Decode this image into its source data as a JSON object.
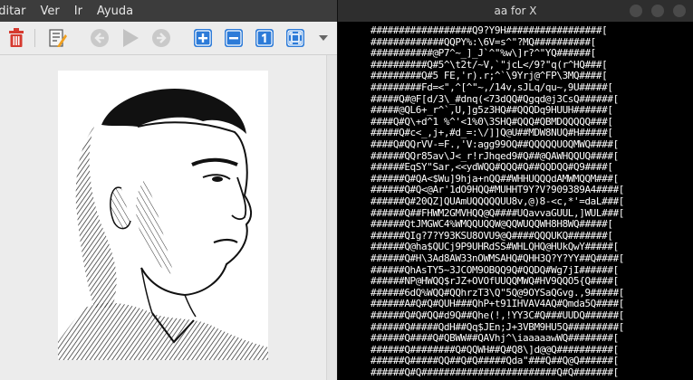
{
  "menubar": {
    "items": [
      "Editar",
      "Ver",
      "Ir",
      "Ayuda"
    ]
  },
  "toolbar": {
    "icons": [
      "trash-icon",
      "edit-icon",
      "back-arrow-icon",
      "play-icon",
      "forward-arrow-icon",
      "zoom-in-icon",
      "zoom-out-icon",
      "zoom-1-icon",
      "fit-icon",
      "dropdown-chevron-icon"
    ],
    "accent_color": "#2d7bd8",
    "delete_color": "#d63a2f"
  },
  "terminal": {
    "title": "aa for X",
    "lines": [
      "##################Q9?Y9H#################[",
      "#############QQPY%:\\6V=s^\"?MQ##########[",
      "###########@P7^~_]_J`^\"%w\\]r?^\"YQ######[",
      "##########Q#5^\\t2t/~V,`\"jcL</9?\"q(r^HQ###[",
      "#########Q#5 FE,'r).r;^`\\9Yrj@^FP\\3MQ####[",
      "#########Fd=<\",^[^\"~,/14v,sJLq/qu~,9U#####[",
      "#####Q#@F[d/3\\_#dnq(<73dQQ#Qgqd@j3CsQ######[",
      "#####@QL6+_r^`,U,]g5z3HQ##QQQDq9HUUH######[",
      "####Q#Q\\+d^1 %^'<1%0\\3SHQ#QQQ#QBMDQQQQQ###[",
      "#####Q#c<_,j+,#d_=:\\/]]Q@U##MDW8NUQ#H#####[",
      "####Q#QQrVV-=F.,'V:agg99OQ##QQQQQUOQMWQ####[",
      "######QQr85av\\J<_r!rJhqed9#Q##@QAWHQQUQ####[",
      "######EqSY\"Sar,<<ydWQQ#QQQ#Q##QQDQQ#Q9####[",
      "######Q#QA<$Wu]9hja+nQQ##WHHUQQQdAMWMQQM###[",
      "######Q#Q<@Ar'1dO9HQQ#MUHHT9Y?V?909389A4####[",
      "######Q#20QZ]QUAmUQQQQQUU8v,@)8-<c,*'=daL###[",
      "######Q##FHWM2GMVHQQ@Q####UQavvaGUUL,]WUL###[",
      "######QtJMGWC4%WMQQUQQW@QQWUQQWH8H8WQ#####[",
      "######QIg?7?Y93KSU8OVU9@Q####QQQUKQ#######[",
      "######Q@ha$QUCj9P9UHRdSS#WHLQHQ@HUkQwY#####[",
      "######Q#H\\3Ad8AW33nOWMSAHQ#QHH3Q?Y?YY##Q####[",
      "######QhAsTY5~3JCOM9OBQQ9Q#QQDQ#Wg7jI######[",
      "######NP@HWQQ$rJZ+OVOfUUQQMWQ#HV9QQO5{Q####[",
      "######6dQ%WQQ#QQhrzT3\\Q\"5Q@9OYSaQGvg.,9#####[",
      "######A#Q#Q#QUH###QhP+t91IHVAV4AQ#Qmda5Q####[",
      "######Q#Q#QQ#d9Q##Qhe(!,!YY3C#Q###UUDQ######[",
      "######Q#####QdH##Qq$JEn;J+3VBM9HU5Q#########[",
      "######Q####Q#QBWW##QAVhj^\\iaaaaawWQ########[",
      "######Q########Q#QQWH##Q#Q8\\]d@@Q##########[",
      "######Q#####QQ##Q#Q#####Qda\"###Q##Q@Q######[",
      "######Q#Q########################Q#Q#######["
    ]
  }
}
